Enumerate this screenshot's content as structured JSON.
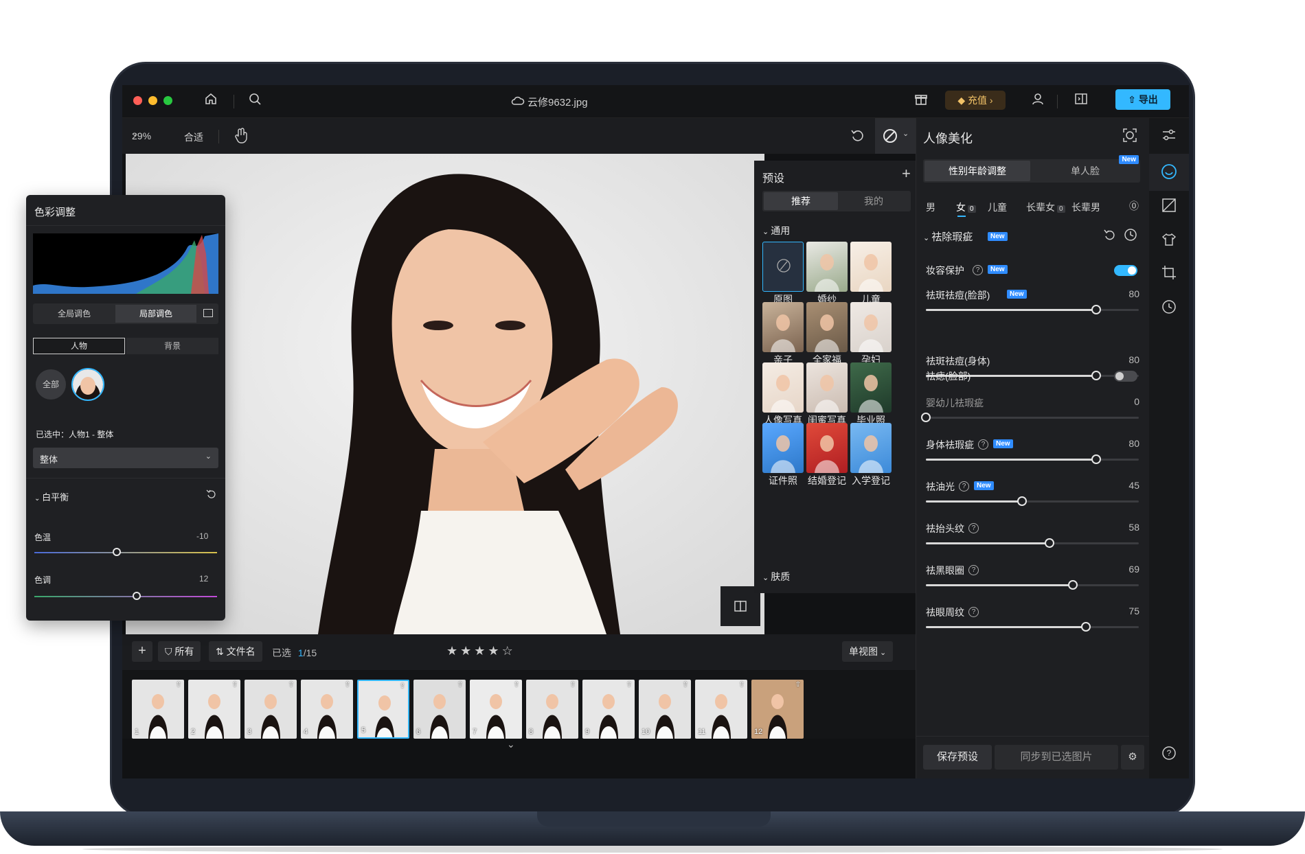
{
  "titlebar": {
    "filename": "云修9632.jpg",
    "recharge_label": "充值",
    "export_label": "导出",
    "icons": [
      "home-icon",
      "search-icon",
      "cloud-icon",
      "gift-icon",
      "diamond-icon",
      "user-icon",
      "sidebar-toggle-icon",
      "upload-icon"
    ]
  },
  "toolbar": {
    "zoom": "29%",
    "fit_label": "合适"
  },
  "presets_panel": {
    "title": "预设",
    "tabs": [
      "推荐",
      "我的"
    ],
    "section_general": "通用",
    "section_skin": "肤质",
    "items": [
      "原图",
      "婚纱",
      "儿童",
      "亲子",
      "全家福",
      "孕妇",
      "人像写真",
      "闺蜜写真",
      "毕业照",
      "证件照",
      "结婚登记",
      "入学登记"
    ]
  },
  "portrait_panel": {
    "title": "人像美化",
    "mode_tabs": [
      "性别年龄调整",
      "单人脸"
    ],
    "new_badge": "New",
    "subject_tabs": [
      {
        "label": "男",
        "count": ""
      },
      {
        "label": "女",
        "count": "0"
      },
      {
        "label": "儿童",
        "count": ""
      },
      {
        "label": "长辈女",
        "count": "0"
      },
      {
        "label": "长辈男",
        "count": ""
      }
    ],
    "section_title": "祛除瑕疵",
    "makeup_protect_label": "妆容保护",
    "makeup_protect_on": true,
    "acne_face_label": "祛痣(脸部)",
    "acne_face_on": false,
    "sliders": [
      {
        "label": "祛斑祛痘(脸部)",
        "value": 80,
        "new": true,
        "help": false
      },
      {
        "label": "祛斑祛痘(身体)",
        "value": 80,
        "new": false,
        "help": false
      },
      {
        "label": "婴幼儿祛瑕疵",
        "value": 0,
        "new": false,
        "help": false
      },
      {
        "label": "身体祛瑕疵",
        "value": 80,
        "new": true,
        "help": true
      },
      {
        "label": "祛油光",
        "value": 45,
        "new": true,
        "help": true
      },
      {
        "label": "祛抬头纹",
        "value": 58,
        "new": false,
        "help": true
      },
      {
        "label": "祛黑眼圈",
        "value": 69,
        "new": false,
        "help": true
      },
      {
        "label": "祛眼周纹",
        "value": 75,
        "new": false,
        "help": true
      }
    ],
    "save_preset_label": "保存预设",
    "sync_label": "同步到已选图片"
  },
  "filmbar": {
    "filter_all": "所有",
    "sort_label": "文件名",
    "selected_label": "已选",
    "selected_count": "1",
    "total_count": "/15",
    "rating": 4,
    "view_mode": "单视图"
  },
  "filmstrip": {
    "items": [
      "1",
      "2",
      "3",
      "4",
      "5",
      "6",
      "7",
      "8",
      "9",
      "10",
      "11",
      "12"
    ],
    "selected_index": 4
  },
  "color_panel": {
    "title": "色彩调整",
    "tabs": [
      "全局调色",
      "局部调色"
    ],
    "subject_tabs": [
      "人物",
      "背景"
    ],
    "all_label": "全部",
    "selected_text": "已选中：人物1 - 整体",
    "scope_value": "整体",
    "section": "白平衡",
    "temp_label": "色温",
    "temp_value": -10,
    "tint_label": "色调",
    "tint_value": 12
  },
  "colors": {
    "accent": "#33b8ff",
    "new_badge": "#2f8cff",
    "recharge": "#f2c267"
  }
}
